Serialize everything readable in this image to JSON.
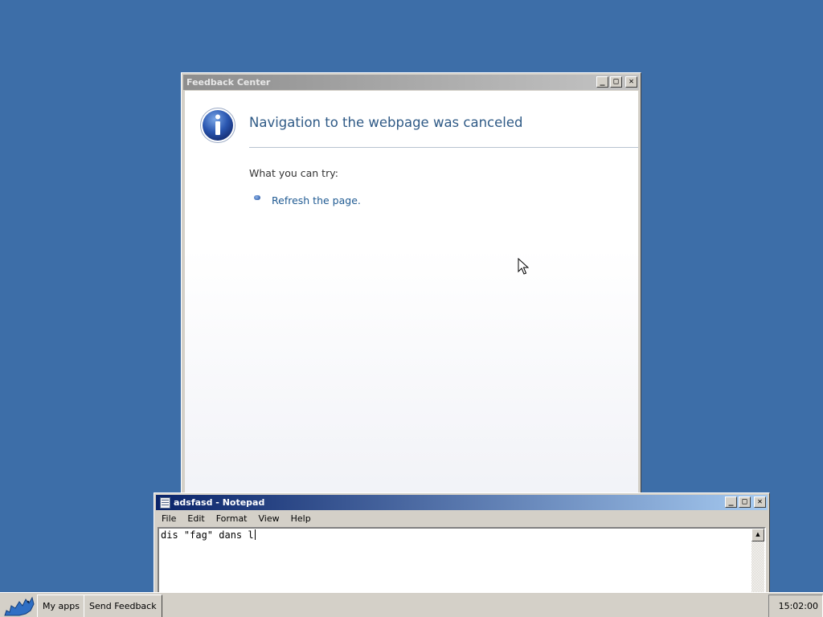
{
  "feedback_window": {
    "title": "Feedback Center",
    "heading": "Navigation to the webpage was canceled",
    "what_you_can_try": "What you can try:",
    "suggestions": [
      "Refresh the page."
    ],
    "title_buttons": {
      "minimize": "_",
      "maximize": "□",
      "close": "✕"
    }
  },
  "notepad": {
    "title": "adsfasd - Notepad",
    "menu": [
      "File",
      "Edit",
      "Format",
      "View",
      "Help"
    ],
    "content": "dis \"fag\" dans l",
    "title_buttons": {
      "minimize": "_",
      "maximize": "□",
      "close": "✕"
    },
    "scroll_up": "▲"
  },
  "taskbar": {
    "buttons": [
      "My apps",
      "Send Feedback"
    ],
    "clock": "15:02:00 PM"
  },
  "colors": {
    "desktop": "#3d6ea8",
    "active_titlebar": "#0a246a",
    "inactive_titlebar": "#8e8e8e",
    "heading_text": "#2f5a86",
    "link_text": "#1f5a92"
  },
  "icons": {
    "info": "info-icon",
    "start": "start-bird-icon",
    "bullet": "blue-bullet-icon",
    "cursor": "mouse-pointer-icon",
    "notepad_app": "notepad-icon"
  }
}
